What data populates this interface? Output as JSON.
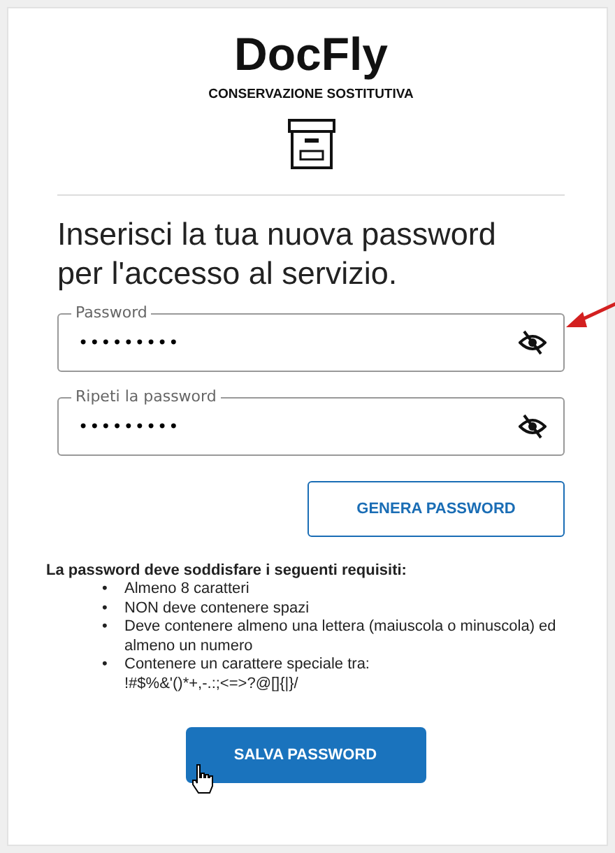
{
  "brand": {
    "title": "DocFly",
    "subtitle": "CONSERVAZIONE SOSTITUTIVA"
  },
  "heading": "Inserisci la tua nuova password per l'accesso al servizio.",
  "fields": [
    {
      "label": "Password",
      "value": "•••••••••"
    },
    {
      "label": "Ripeti la password",
      "value": "•••••••••"
    }
  ],
  "generate_button": "GENERA PASSWORD",
  "requirements": {
    "title": "La password deve soddisfare i seguenti requisiti:",
    "items": [
      {
        "marker": "•",
        "text": "Almeno 8 caratteri"
      },
      {
        "marker": "•",
        "text": "NON deve contenere spazi"
      },
      {
        "marker": "•",
        "text": "Deve contenere almeno una lettera (maiuscola o minuscola) ed almeno un numero"
      },
      {
        "marker": "•",
        "text": "Contenere un carattere speciale tra:\n!#$%&'()*+,-.:;<=>?@[]{|}/"
      }
    ]
  },
  "save_button": "SALVA PASSWORD"
}
